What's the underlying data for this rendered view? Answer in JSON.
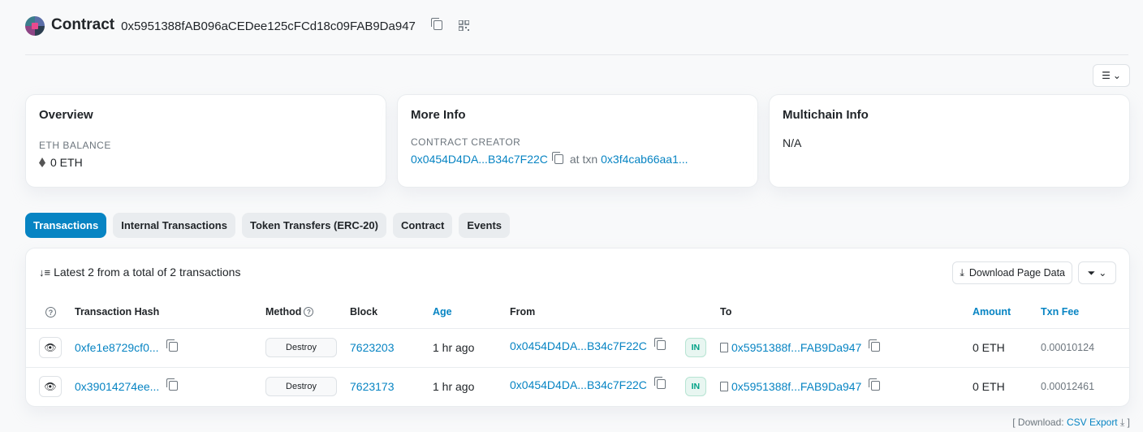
{
  "header": {
    "title": "Contract",
    "address": "0x5951388fAB096aCEDee125cFCd18c09FAB9Da947"
  },
  "overview": {
    "title": "Overview",
    "eth_balance_label": "ETH BALANCE",
    "eth_balance_value": "0 ETH"
  },
  "more_info": {
    "title": "More Info",
    "creator_label": "CONTRACT CREATOR",
    "creator_address": "0x0454D4DA...B34c7F22C",
    "at_txn_text": "at txn",
    "creator_txn": "0x3f4cab66aa1..."
  },
  "multichain": {
    "title": "Multichain Info",
    "value": "N/A"
  },
  "tabs": [
    {
      "label": "Transactions",
      "active": true
    },
    {
      "label": "Internal Transactions",
      "active": false
    },
    {
      "label": "Token Transfers (ERC-20)",
      "active": false
    },
    {
      "label": "Contract",
      "active": false
    },
    {
      "label": "Events",
      "active": false
    }
  ],
  "table": {
    "summary": "Latest 2 from a total of 2 transactions",
    "download_label": "Download Page Data",
    "columns": {
      "hash": "Transaction Hash",
      "method": "Method",
      "block": "Block",
      "age": "Age",
      "from": "From",
      "to": "To",
      "amount": "Amount",
      "fee": "Txn Fee"
    },
    "rows": [
      {
        "hash": "0xfe1e8729cf0...",
        "method": "Destroy",
        "block": "7623203",
        "age": "1 hr ago",
        "from": "0x0454D4DA...B34c7F22C",
        "direction": "IN",
        "to": "0x5951388f...FAB9Da947",
        "amount": "0 ETH",
        "fee": "0.00010124"
      },
      {
        "hash": "0x39014274ee...",
        "method": "Destroy",
        "block": "7623173",
        "age": "1 hr ago",
        "from": "0x0454D4DA...B34c7F22C",
        "direction": "IN",
        "to": "0x5951388f...FAB9Da947",
        "amount": "0 ETH",
        "fee": "0.00012461"
      }
    ]
  },
  "footer": {
    "prefix": "[ Download:",
    "link": "CSV Export",
    "suffix": "]"
  },
  "colors": {
    "accent": "#0784c3",
    "in_badge": "#00a186"
  }
}
